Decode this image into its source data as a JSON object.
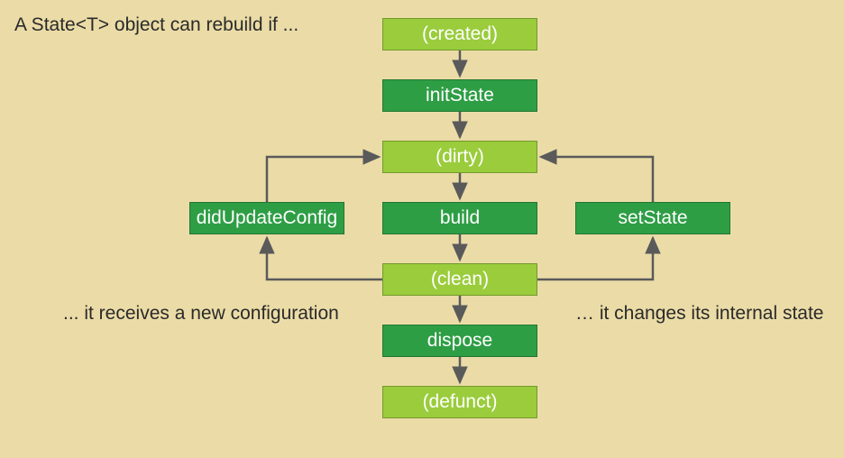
{
  "title": "A State<T> object can rebuild if ...",
  "nodes": {
    "created": "(created)",
    "initState": "initState",
    "dirty": "(dirty)",
    "build": "build",
    "clean": "(clean)",
    "dispose": "dispose",
    "defunct": "(defunct)",
    "didUpdateConfig": "didUpdateConfig",
    "setState": "setState"
  },
  "captions": {
    "left": "... it receives a new configuration",
    "right": "… it changes its internal state"
  },
  "colors": {
    "light": "#9acc3c",
    "dark": "#2e9e45",
    "arrow": "#5a5a5a",
    "bg": "#ebdca7"
  },
  "chart_data": {
    "type": "flowchart",
    "edges": [
      {
        "from": "created",
        "to": "initState"
      },
      {
        "from": "initState",
        "to": "dirty"
      },
      {
        "from": "dirty",
        "to": "build"
      },
      {
        "from": "build",
        "to": "clean"
      },
      {
        "from": "clean",
        "to": "dispose"
      },
      {
        "from": "dispose",
        "to": "defunct"
      },
      {
        "from": "clean",
        "to": "didUpdateConfig"
      },
      {
        "from": "didUpdateConfig",
        "to": "dirty"
      },
      {
        "from": "clean",
        "to": "setState"
      },
      {
        "from": "setState",
        "to": "dirty"
      }
    ]
  }
}
